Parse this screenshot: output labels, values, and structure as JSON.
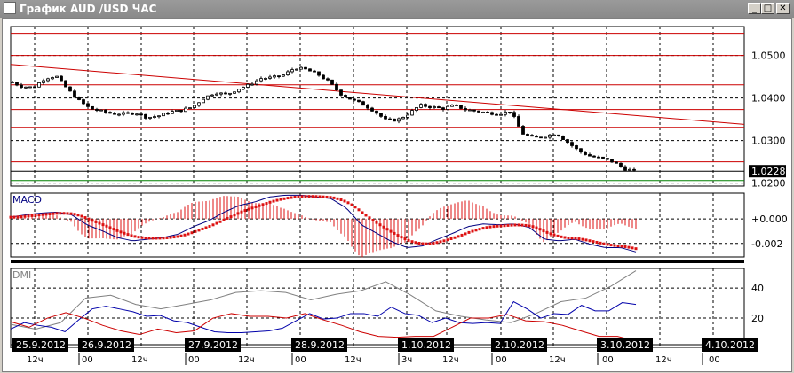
{
  "window": {
    "title": "График AUD /USD  ЧАС",
    "minimize": "_",
    "maximize": "□",
    "close": "✕"
  },
  "colors": {
    "level": "#cc0000",
    "grid": "#000000",
    "macd": "#000080",
    "signal": "#dd1111",
    "adx": "#808080",
    "plus_di": "#0000aa",
    "minus_di": "#cc0000",
    "support": "#008000"
  },
  "chart_data": [
    {
      "type": "candlestick",
      "title": "AUD/USD H1",
      "price_axis": {
        "ticks": [
          "1.0500",
          "1.0400",
          "1.0300",
          "1.0200"
        ],
        "tick_values": [
          1.05,
          1.04,
          1.03,
          1.02
        ],
        "ylim": [
          1.0193,
          1.0568
        ]
      },
      "last_price": "1.0228",
      "last_price_value": 1.0228,
      "levels": [
        1.0552,
        1.05,
        1.0431,
        1.0373,
        1.0331,
        1.025
      ],
      "support_line": 1.0206,
      "trendline": {
        "start": 1.0479,
        "end": 1.0338
      },
      "closes": [
        1.0438,
        1.0427,
        1.0425,
        1.0446,
        1.0452,
        1.0421,
        1.0394,
        1.0375,
        1.0369,
        1.0363,
        1.0363,
        1.0365,
        1.0354,
        1.0358,
        1.0367,
        1.0371,
        1.0379,
        1.04,
        1.0413,
        1.0408,
        1.0421,
        1.0431,
        1.0446,
        1.0448,
        1.0454,
        1.0471,
        1.0467,
        1.0456,
        1.0438,
        1.041,
        1.0396,
        1.0385,
        1.0369,
        1.0348,
        1.0348,
        1.0363,
        1.0383,
        1.0379,
        1.0375,
        1.0383,
        1.0373,
        1.0369,
        1.0365,
        1.0363,
        1.0369,
        1.0317,
        1.0306,
        1.031,
        1.0317,
        1.0296,
        1.0275,
        1.0263,
        1.0258,
        1.025,
        1.0233,
        1.0228
      ]
    },
    {
      "type": "line",
      "title": "MACD",
      "ticks": [
        "+0.000",
        "-0.002"
      ],
      "tick_values": [
        0,
        -0.002
      ],
      "ylim": [
        -0.0031,
        0.0021
      ],
      "macd": [
        0.00014,
        0.00034,
        0.00048,
        0.00055,
        0.00034,
        -0.00048,
        -0.00097,
        -0.00152,
        -0.00179,
        -0.00166,
        -0.00152,
        -0.00124,
        -0.00062,
        -0.00014,
        0.00055,
        0.0011,
        0.00138,
        0.00179,
        0.00193,
        0.00193,
        0.00179,
        0.00166,
        0.0009,
        -0.00048,
        -0.00117,
        -0.00186,
        -0.00234,
        -0.00221,
        -0.00166,
        -0.00117,
        -0.00062,
        -0.00041,
        -0.00048,
        -0.00041,
        -0.00069,
        -0.00166,
        -0.00179,
        -0.00166,
        -0.00207,
        -0.00234,
        -0.00234,
        -0.00269
      ]
    },
    {
      "type": "line",
      "title": "DMI",
      "ticks": [
        "40",
        "20"
      ],
      "tick_values": [
        40,
        20
      ],
      "ylim": [
        0,
        53
      ],
      "adx": [
        15.8,
        12.7,
        17.0,
        33.3,
        35.2,
        29.1,
        26.1,
        29.1,
        32.1,
        37.0,
        38.2,
        37.0,
        32.1,
        35.8,
        38.2,
        44.2,
        35.2,
        24.8,
        21.2,
        18.8,
        17.0,
        23.0,
        30.9,
        33.3,
        41.2,
        51.5
      ],
      "plus_di": [
        12.7,
        17.0,
        15.2,
        13.9,
        10.9,
        18.8,
        26.1,
        27.9,
        26.1,
        24.2,
        21.2,
        21.8,
        18.2,
        17.0,
        13.9,
        10.9,
        10.3,
        10.3,
        10.9,
        11.5,
        13.3,
        18.2,
        23.0,
        19.4,
        20.0,
        23.0,
        23.0,
        21.2,
        27.3,
        23.0,
        21.8,
        17.0,
        20.0,
        17.0,
        16.4,
        17.0,
        16.4,
        30.9,
        26.1,
        20.0,
        23.0,
        22.4,
        28.5,
        24.8,
        24.8,
        30.3,
        29.1
      ],
      "minus_di": [
        17.6,
        13.9,
        20.0,
        23.6,
        20.0,
        15.2,
        11.5,
        9.1,
        12.7,
        10.3,
        11.5,
        20.0,
        23.0,
        21.2,
        21.2,
        20.0,
        23.0,
        18.8,
        15.2,
        10.9,
        7.9,
        7.3,
        7.9,
        7.9,
        13.9,
        20.0,
        20.0,
        22.4,
        18.2,
        17.6,
        15.2,
        11.5,
        7.9,
        7.9,
        4.8
      ]
    }
  ],
  "time_axis": {
    "dates": [
      "25.9.2012",
      "26.9.2012",
      "27.9.2012",
      "28.9.2012",
      "1.10.2012",
      "2.10.2012",
      "3.10.2012",
      "4.10.2012"
    ],
    "hours": [
      "12ч",
      "00",
      "12ч",
      "00",
      "12ч",
      "00",
      "12ч",
      "3ч",
      "12ч",
      "00",
      "12ч",
      "00",
      "12ч",
      "00"
    ]
  }
}
